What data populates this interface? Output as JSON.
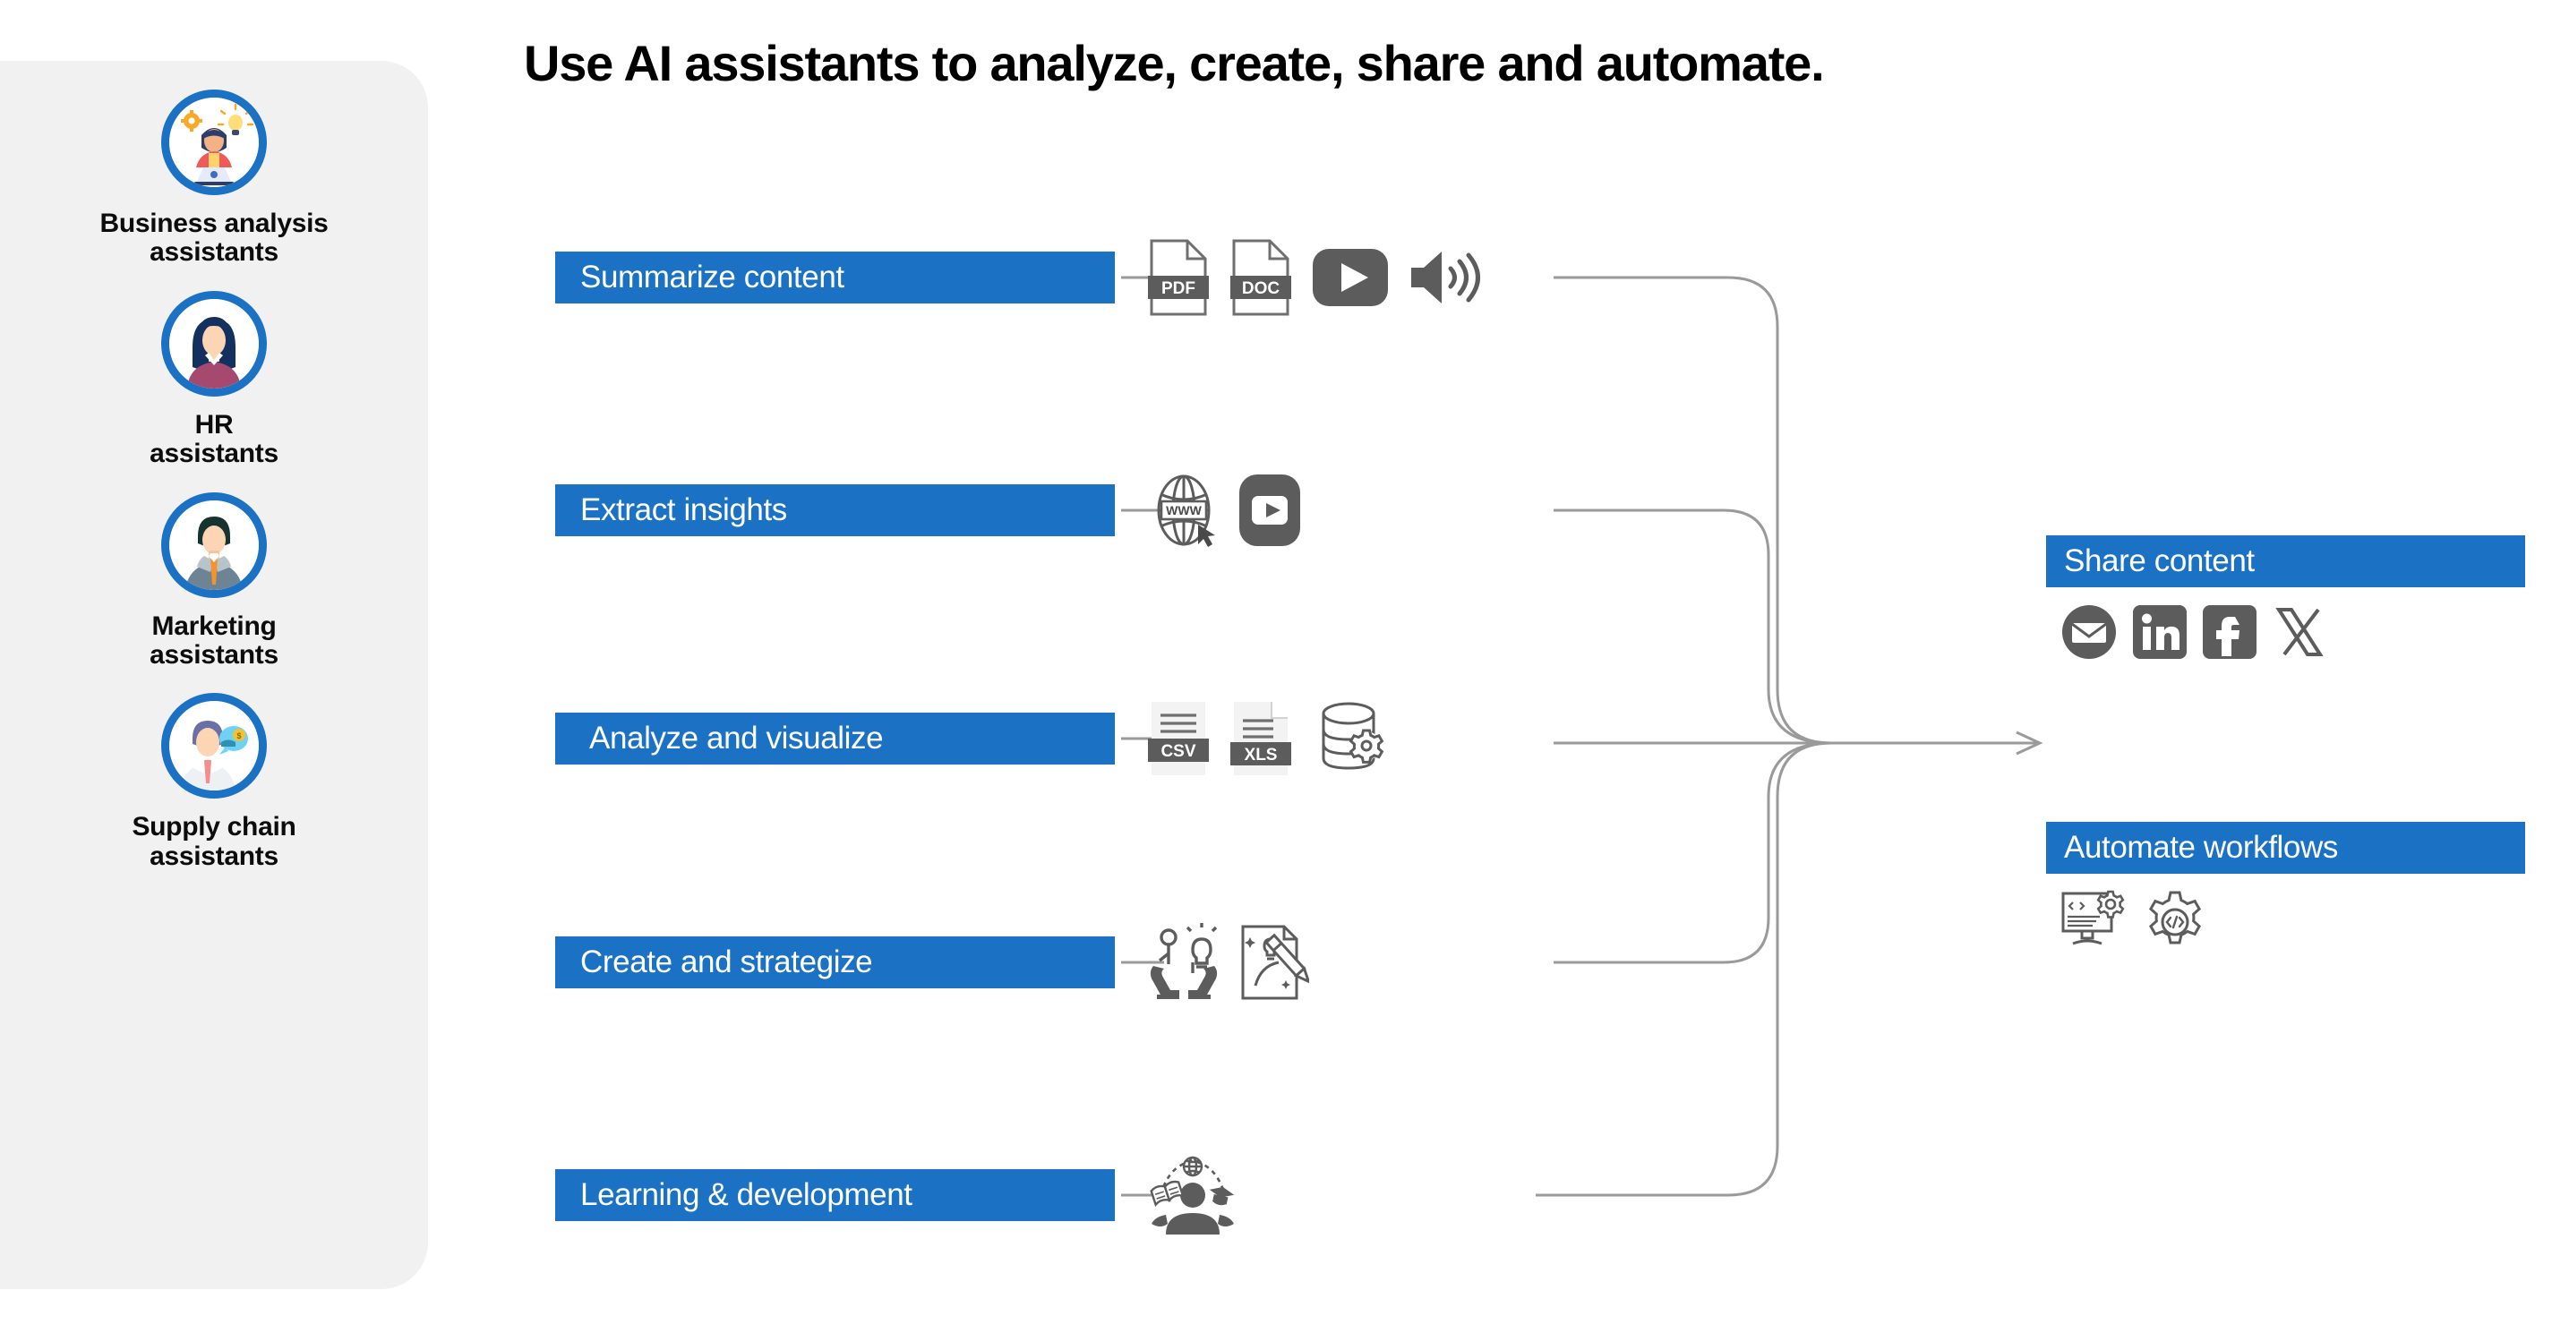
{
  "title": "Use AI assistants to analyze, create, share and automate.",
  "colors": {
    "accent": "#1b72c4",
    "sidebar_bg": "#f1f1f1",
    "icon_gray": "#5c5c5c",
    "line_gray": "#9a9a9a"
  },
  "sidebar": {
    "items": [
      {
        "label": "Business analysis\nassistants",
        "icon": "business-analyst-avatar-icon"
      },
      {
        "label": "HR\nassistants",
        "icon": "hr-avatar-icon"
      },
      {
        "label": "Marketing\nassistants",
        "icon": "marketing-avatar-icon"
      },
      {
        "label": "Supply chain\nassistants",
        "icon": "supply-chain-avatar-icon"
      }
    ]
  },
  "flow": {
    "rows": [
      {
        "label": "Summarize content",
        "icons": [
          "pdf-file-icon",
          "doc-file-icon",
          "video-play-icon",
          "audio-speaker-icon"
        ]
      },
      {
        "label": "Extract insights",
        "icons": [
          "www-globe-icon",
          "video-play-icon"
        ]
      },
      {
        "label": "Analyze and visualize",
        "icons": [
          "csv-file-icon",
          "xls-file-icon",
          "database-gear-icon"
        ]
      },
      {
        "label": "Create and strategize",
        "icons": [
          "hands-idea-icon",
          "design-pencil-icon"
        ]
      },
      {
        "label": "Learning & development",
        "icons": [
          "learning-person-icon"
        ]
      }
    ]
  },
  "outputs": [
    {
      "label": "Share content",
      "icons": [
        "email-icon",
        "linkedin-icon",
        "facebook-icon",
        "x-twitter-icon"
      ]
    },
    {
      "label": "Automate workflows",
      "icons": [
        "code-monitor-icon",
        "gear-code-icon"
      ]
    }
  ]
}
